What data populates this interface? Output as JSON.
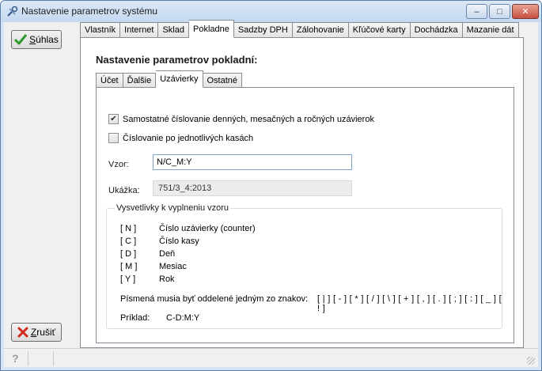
{
  "window": {
    "title": "Nastavenie parametrov systému",
    "minimize": "–",
    "maximize": "□",
    "close": "✕"
  },
  "side": {
    "ok_label": "Súhlas",
    "cancel_label": "Zrušiť"
  },
  "tabs_top": [
    {
      "label": "Vlastník",
      "active": false
    },
    {
      "label": "Internet",
      "active": false
    },
    {
      "label": "Sklad",
      "active": false
    },
    {
      "label": "Pokladne",
      "active": true
    },
    {
      "label": "Sadzby DPH",
      "active": false
    },
    {
      "label": "Zálohovanie",
      "active": false
    },
    {
      "label": "Kľúčové karty",
      "active": false
    },
    {
      "label": "Dochádzka",
      "active": false
    },
    {
      "label": "Mazanie dát",
      "active": false
    }
  ],
  "panel": {
    "heading": "Nastavenie parametrov pokladní:"
  },
  "tabs_inner": [
    {
      "label": "Účet",
      "active": false
    },
    {
      "label": "Ďalšie",
      "active": false
    },
    {
      "label": "Uzávierky",
      "active": true
    },
    {
      "label": "Ostatné",
      "active": false
    }
  ],
  "options": {
    "separate_numbering": {
      "label": "Samostatné číslovanie denných, mesačných a ročných uzávierok",
      "checked": true
    },
    "per_register": {
      "label": "Číslovanie po jednotlivých kasách",
      "checked": false
    }
  },
  "fields": {
    "vzor_label": "Vzor:",
    "vzor_value": "N/C_M:Y",
    "ukazka_label": "Ukážka:",
    "ukazka_value": "751/3_4:2013"
  },
  "legend": {
    "title": "Vysvetlivky k vyplneniu vzoru",
    "items": [
      {
        "key": "[ N ]",
        "desc": "Číslo uzávierky (counter)"
      },
      {
        "key": "[ C ]",
        "desc": "Číslo kasy"
      },
      {
        "key": "[ D ]",
        "desc": "Deň"
      },
      {
        "key": "[ M ]",
        "desc": "Mesiac"
      },
      {
        "key": "[ Y ]",
        "desc": "Rok"
      }
    ],
    "separator_text": "Písmená musia byť oddelené jedným zo znakov:",
    "separator_chars": "[ | ] [ - ] [ * ] [ / ] [ \\ ] [ + ] [ , ] [ . ] [ ; ] [ : ] [ _ ] [ ! ]",
    "example_label": "Príklad:",
    "example_value": "C-D:M:Y"
  },
  "colors": {
    "ok_check": "#2e9a2e",
    "cancel_x": "#d02a1e"
  }
}
